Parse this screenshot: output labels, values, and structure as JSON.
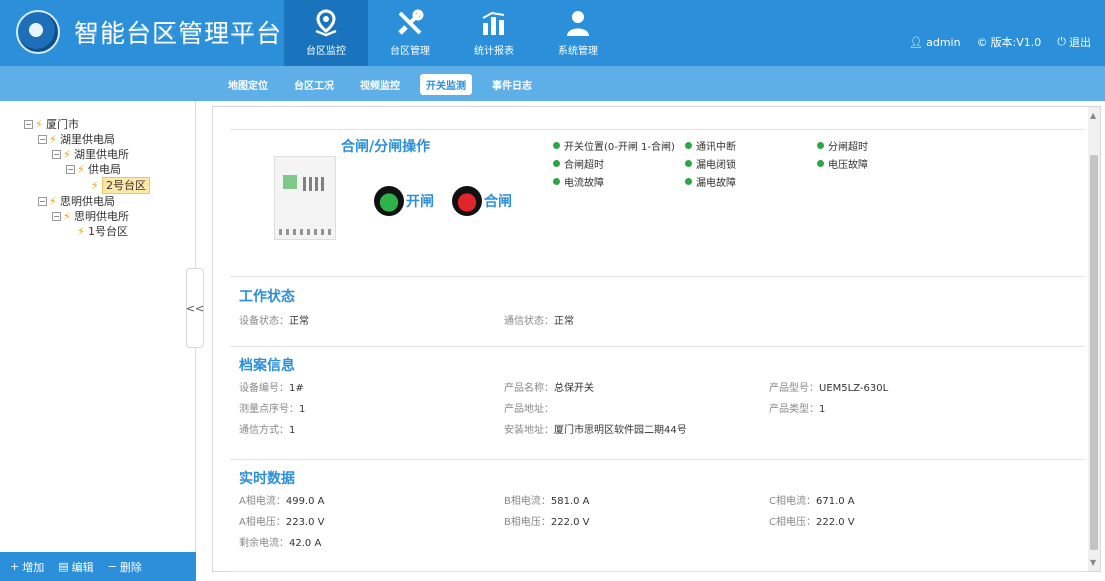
{
  "header": {
    "title": "智能台区管理平台",
    "nav": [
      {
        "label": "台区监控",
        "icon": "location-pin-icon",
        "active": true
      },
      {
        "label": "台区管理",
        "icon": "tools-icon",
        "active": false
      },
      {
        "label": "统计报表",
        "icon": "bar-chart-icon",
        "active": false
      },
      {
        "label": "系统管理",
        "icon": "user-icon",
        "active": false
      }
    ],
    "user": "admin",
    "version": "版本:V1.0",
    "logout": "退出"
  },
  "subnav": [
    "地图定位",
    "台区工况",
    "视频监控",
    "开关监测",
    "事件日志"
  ],
  "subnav_active": "开关监测",
  "tree": [
    {
      "label": "厦门市",
      "level": 0,
      "toggle": "⊟"
    },
    {
      "label": "湖里供电局",
      "level": 1,
      "toggle": "⊟"
    },
    {
      "label": "湖里供电所",
      "level": 2,
      "toggle": "⊟"
    },
    {
      "label": "供电局",
      "level": 3,
      "toggle": "⊟"
    },
    {
      "label": "2号台区",
      "level": 4,
      "toggle": "",
      "selected": true
    },
    {
      "label": "思明供电局",
      "level": 1,
      "toggle": "⊟"
    },
    {
      "label": "思明供电所",
      "level": 2,
      "toggle": "⊟"
    },
    {
      "label": "1号台区",
      "level": 3,
      "toggle": ""
    }
  ],
  "sidebar_actions": {
    "add": "增加",
    "edit": "编辑",
    "delete": "删除"
  },
  "collapse_label": "<<",
  "switch_op": {
    "title": "合闸/分闸操作",
    "open_label": "开闸",
    "close_label": "合闸",
    "open_color": "#2db34a",
    "close_color": "#e0262b",
    "status": [
      "开关位置(0-开闸 1-合闸)",
      "通讯中断",
      "分闸超时",
      "合闸超时",
      "漏电闭锁",
      "电压故障",
      "电流故障",
      "漏电故障"
    ]
  },
  "work_status": {
    "title": "工作状态",
    "device_status_label": "设备状态：",
    "device_status": "正常",
    "comm_status_label": "通信状态：",
    "comm_status": "正常"
  },
  "archive": {
    "title": "档案信息",
    "rows": [
      [
        {
          "label": "设备编号：",
          "value": "1#"
        },
        {
          "label": "产品名称：",
          "value": "总保开关"
        },
        {
          "label": "产品型号：",
          "value": "UEM5LZ-630L"
        }
      ],
      [
        {
          "label": "测量点序号：",
          "value": "1"
        },
        {
          "label": "产品地址：",
          "value": ""
        },
        {
          "label": "产品类型：",
          "value": "1"
        }
      ],
      [
        {
          "label": "通信方式：",
          "value": "1"
        },
        {
          "label": "安装地址：",
          "value": "厦门市思明区软件园二期44号"
        },
        {
          "label": "",
          "value": ""
        }
      ]
    ]
  },
  "realtime": {
    "title": "实时数据",
    "rows": [
      [
        {
          "label": "A相电流：",
          "value": "499.0 A"
        },
        {
          "label": "B相电流：",
          "value": "581.0 A"
        },
        {
          "label": "C相电流：",
          "value": "671.0 A"
        }
      ],
      [
        {
          "label": "A相电压：",
          "value": "223.0 V"
        },
        {
          "label": "B相电压：",
          "value": "222.0 V"
        },
        {
          "label": "C相电压：",
          "value": "222.0 V"
        }
      ],
      [
        {
          "label": "剩余电流：",
          "value": "42.0 A"
        },
        {
          "label": "",
          "value": ""
        },
        {
          "label": "",
          "value": ""
        }
      ]
    ]
  }
}
